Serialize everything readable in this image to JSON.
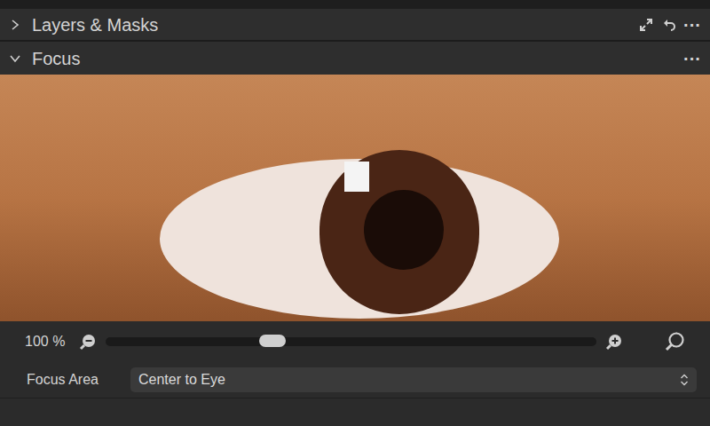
{
  "sections": [
    {
      "title": "Layers & Masks",
      "expanded": false,
      "menu": "···"
    },
    {
      "title": "Focus",
      "expanded": true,
      "menu": "···"
    }
  ],
  "focus": {
    "zoom": {
      "reading": "100 %",
      "level": 0.34
    },
    "focus_area": {
      "label": "Focus Area",
      "value": "Center to Eye"
    }
  }
}
